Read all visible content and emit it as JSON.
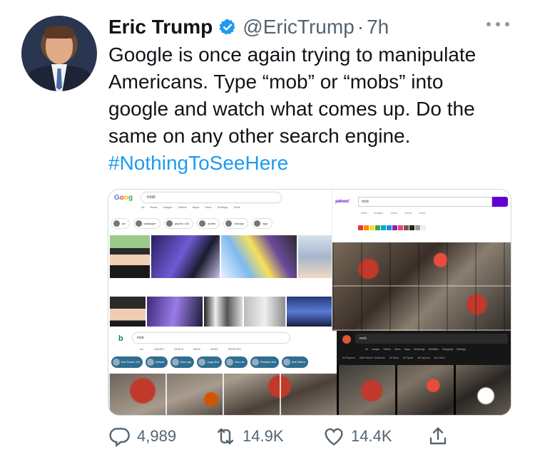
{
  "tweet": {
    "name": "Eric Trump",
    "handle": "@EricTrump",
    "separator": "·",
    "time": "7h",
    "text_main": "Google is once again trying to manipulate Americans. Type “mob” or “mobs” into google and watch what comes up. Do the same on any other search engine. ",
    "hashtag": "#NothingToSeeHere"
  },
  "media": {
    "google": {
      "logo": [
        "G",
        "o",
        "o",
        "g"
      ],
      "query": "mob",
      "tabs": [
        "All",
        "News",
        "Images",
        "Videos",
        "Maps",
        "More",
        "Settings",
        "Tools"
      ],
      "chips": [
        "art",
        "wallpaper",
        "psycho 100",
        "anime",
        "chicago",
        "logo"
      ]
    },
    "yahoo": {
      "logo": "yahoo!",
      "query": "mob",
      "tabs": [
        "Web",
        "Images",
        "Video",
        "News",
        "More"
      ]
    },
    "bing": {
      "logo": "b",
      "query": "mob",
      "tabs": [
        "ALL",
        "IMAGES",
        "VIDEOS",
        "MAPS",
        "NEWS",
        "SHOPPING"
      ],
      "chips": [
        "Mob Psycho 100",
        "Mobster",
        "Mob Logo",
        "Angry Mob",
        "Mob Life",
        "PlexMark Mob",
        "Mob Tattoos"
      ]
    },
    "duckduckgo": {
      "query": "mob",
      "tabs": [
        "All",
        "Images",
        "Videos",
        "News",
        "Maps",
        "Meanings",
        "Definition",
        "Shopping",
        "Settings"
      ],
      "filters": [
        "All Regions",
        "Safe Search: Moderate",
        "All Sizes",
        "All Types",
        "All Layouts",
        "All Colors"
      ]
    }
  },
  "actions": {
    "replies": "4,989",
    "retweets": "14.9K",
    "likes": "14.4K"
  },
  "colors": {
    "accent": "#1d9bf0",
    "muted": "#536471",
    "text": "#0f1419"
  }
}
